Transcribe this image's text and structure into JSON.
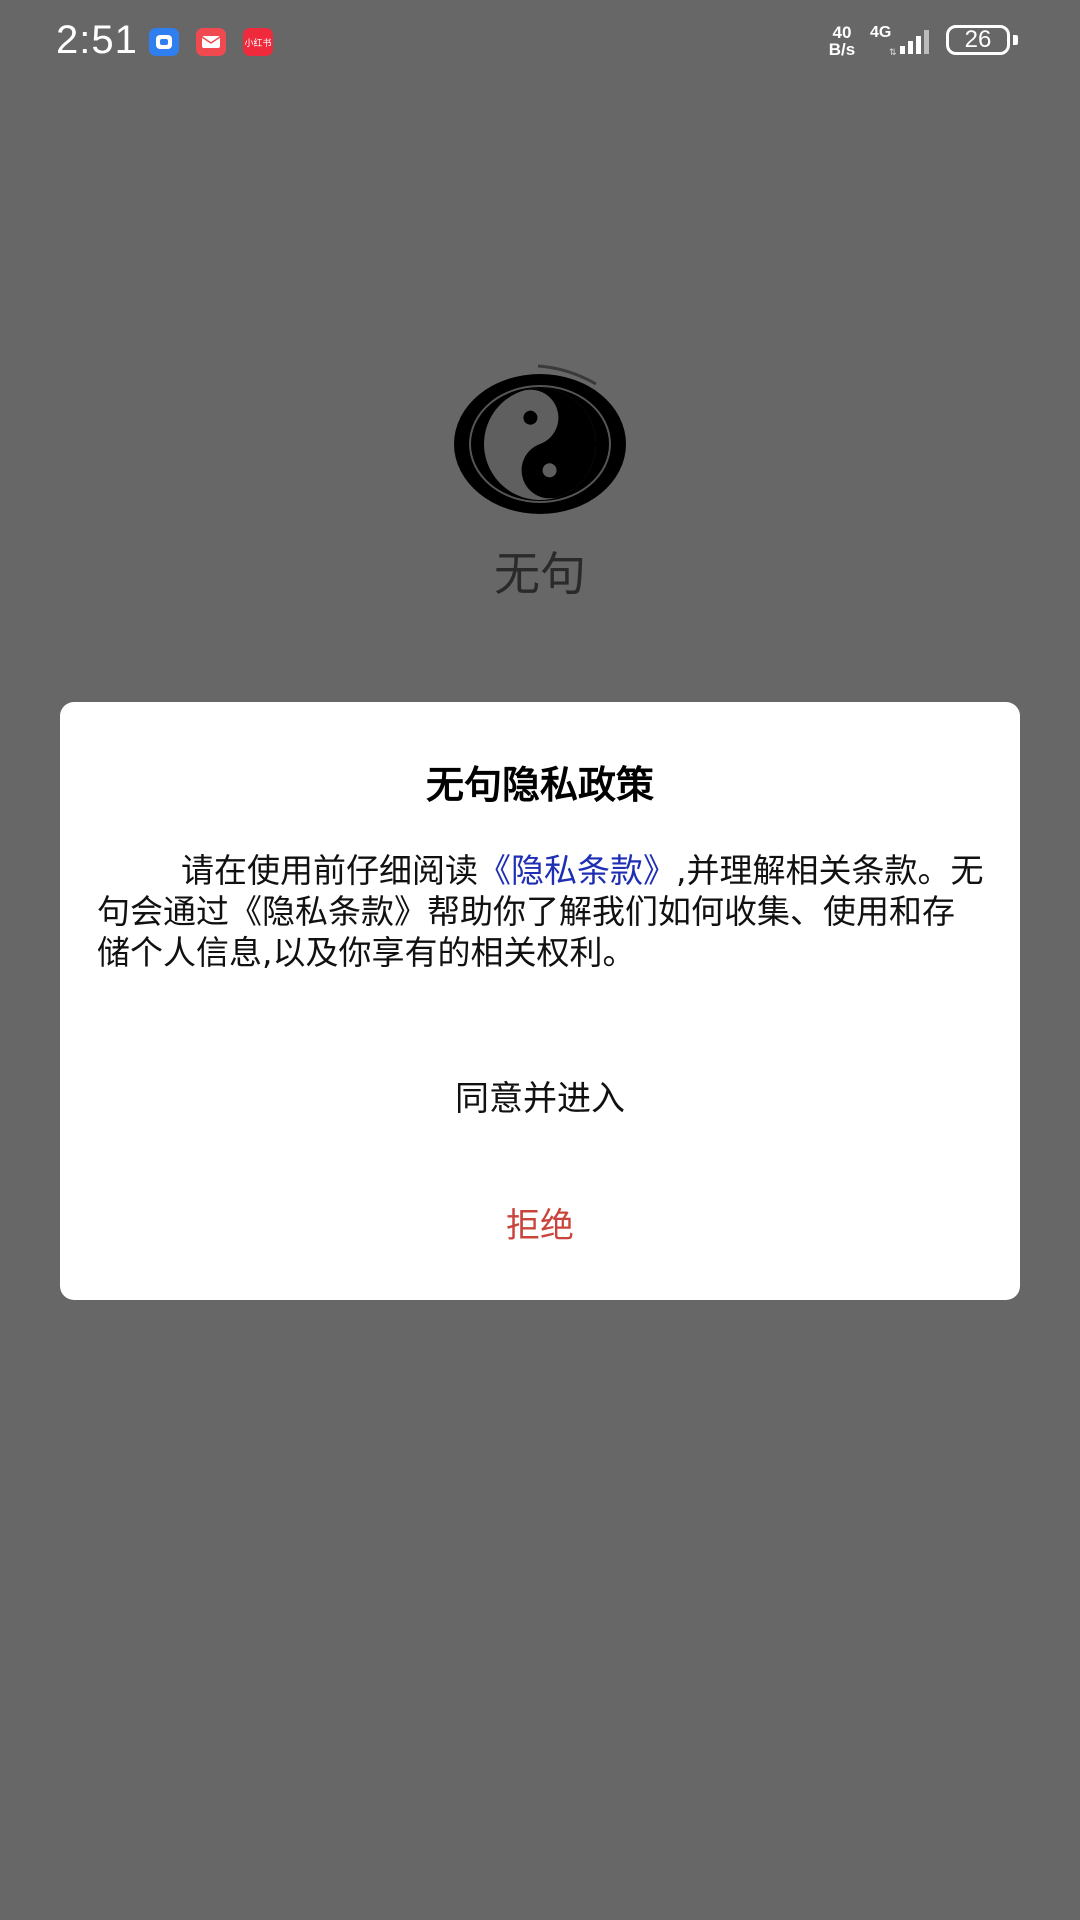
{
  "status_bar": {
    "time": "2:51",
    "net_speed_value": "40",
    "net_speed_unit": "B/s",
    "network_type": "4G",
    "battery_level": "26",
    "notification_3_text": "小红书"
  },
  "splash": {
    "app_name": "无句",
    "logo_icon": "yin-yang-icon"
  },
  "dialog": {
    "title": "无句隐私政策",
    "body_prefix": "请在使用前仔细阅读",
    "body_link": "《隐私条款》",
    "body_suffix": ",并理解相关条款。无句会通过《隐私条款》帮助你了解我们如何收集、使用和存储个人信息,以及你享有的相关权利。",
    "agree_label": "同意并进入",
    "reject_label": "拒绝"
  },
  "colors": {
    "background": "#676767",
    "dialog_bg": "#ffffff",
    "link": "#1f2fb5",
    "reject": "#c9453b"
  }
}
